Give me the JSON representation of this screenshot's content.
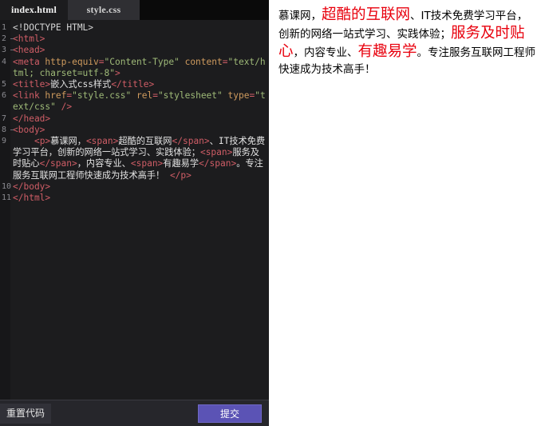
{
  "editor": {
    "tabs": [
      {
        "label": "index.html",
        "active": true
      },
      {
        "label": "style.css",
        "active": false
      }
    ],
    "line_numbers": [
      "1",
      "2",
      "3",
      "4",
      "",
      "5",
      "6",
      "",
      "7",
      "8",
      "9",
      "",
      "",
      "",
      "",
      "",
      "10",
      "11"
    ],
    "code_lines": [
      {
        "n": "1",
        "fold": false,
        "tokens": [
          {
            "t": "<!DOCTYPE HTML>",
            "c": "doctype"
          }
        ]
      },
      {
        "n": "2",
        "fold": true,
        "tokens": [
          {
            "t": "<html>",
            "c": "tag"
          }
        ]
      },
      {
        "n": "3",
        "fold": true,
        "tokens": [
          {
            "t": "<head>",
            "c": "tag"
          }
        ]
      },
      {
        "n": "4",
        "fold": false,
        "tokens": [
          {
            "t": "<meta ",
            "c": "tag"
          },
          {
            "t": "http-equiv",
            "c": "attr"
          },
          {
            "t": "=",
            "c": "tag"
          },
          {
            "t": "\"Content-Type\"",
            "c": "val"
          },
          {
            "t": " ",
            "c": "tag"
          },
          {
            "t": "content",
            "c": "attr"
          },
          {
            "t": "=",
            "c": "tag"
          },
          {
            "t": "\"text/html; charset=utf-8\"",
            "c": "val"
          },
          {
            "t": ">",
            "c": "tag"
          }
        ]
      },
      {
        "n": "5",
        "fold": false,
        "tokens": [
          {
            "t": "<title>",
            "c": "tag"
          },
          {
            "t": "嵌入式css样式",
            "c": "text"
          },
          {
            "t": "</title>",
            "c": "tag"
          }
        ]
      },
      {
        "n": "6",
        "fold": false,
        "tokens": [
          {
            "t": "<link ",
            "c": "tag"
          },
          {
            "t": "href",
            "c": "attr"
          },
          {
            "t": "=",
            "c": "tag"
          },
          {
            "t": "\"style.css\"",
            "c": "val"
          },
          {
            "t": " ",
            "c": "tag"
          },
          {
            "t": "rel",
            "c": "attr"
          },
          {
            "t": "=",
            "c": "tag"
          },
          {
            "t": "\"stylesheet\"",
            "c": "val"
          },
          {
            "t": " ",
            "c": "tag"
          },
          {
            "t": "type",
            "c": "attr"
          },
          {
            "t": "=",
            "c": "tag"
          },
          {
            "t": "\"text/css\"",
            "c": "val"
          },
          {
            "t": " />",
            "c": "tag"
          }
        ]
      },
      {
        "n": "7",
        "fold": false,
        "tokens": [
          {
            "t": "</head>",
            "c": "tag"
          }
        ]
      },
      {
        "n": "8",
        "fold": true,
        "tokens": [
          {
            "t": "<body>",
            "c": "tag"
          }
        ]
      },
      {
        "n": "9",
        "fold": false,
        "tokens": [
          {
            "t": "    ",
            "c": "text"
          },
          {
            "t": "<p>",
            "c": "tag"
          },
          {
            "t": "慕课网，",
            "c": "text"
          },
          {
            "t": "<span>",
            "c": "tag"
          },
          {
            "t": "超酷的互联网",
            "c": "text"
          },
          {
            "t": "</span>",
            "c": "tag"
          },
          {
            "t": "、IT技术免费学习平台，创新的网络一站式学习、实践体验；",
            "c": "text"
          },
          {
            "t": "<span>",
            "c": "tag"
          },
          {
            "t": "服务及时贴心",
            "c": "text"
          },
          {
            "t": "</span>",
            "c": "tag"
          },
          {
            "t": "，内容专业、",
            "c": "text"
          },
          {
            "t": "<span>",
            "c": "tag"
          },
          {
            "t": "有趣易学",
            "c": "text"
          },
          {
            "t": "</span>",
            "c": "tag"
          },
          {
            "t": "。专注服务互联网工程师快速成为技术高手！ ",
            "c": "text"
          },
          {
            "t": "</p>",
            "c": "tag"
          }
        ]
      },
      {
        "n": "10",
        "fold": false,
        "tokens": [
          {
            "t": "</body>",
            "c": "tag"
          }
        ]
      },
      {
        "n": "11",
        "fold": false,
        "tokens": [
          {
            "t": "</html>",
            "c": "tag"
          }
        ]
      }
    ]
  },
  "toolbar": {
    "reset_label": "重置代码",
    "submit_label": "提交",
    "submit_color": "#5b53b5"
  },
  "preview": {
    "highlight_color": "#e8000d",
    "segments": [
      {
        "text": "慕课网，",
        "highlight": false
      },
      {
        "text": "超酷的互联网",
        "highlight": true
      },
      {
        "text": "、IT技术免费学习平台，创新的网络一站式学习、实践体验；",
        "highlight": false
      },
      {
        "text": "服务及时贴心",
        "highlight": true
      },
      {
        "text": "，内容专业、",
        "highlight": false
      },
      {
        "text": "有趣易学",
        "highlight": true
      },
      {
        "text": "。专注服务互联网工程师快速成为技术高手！",
        "highlight": false
      }
    ]
  }
}
